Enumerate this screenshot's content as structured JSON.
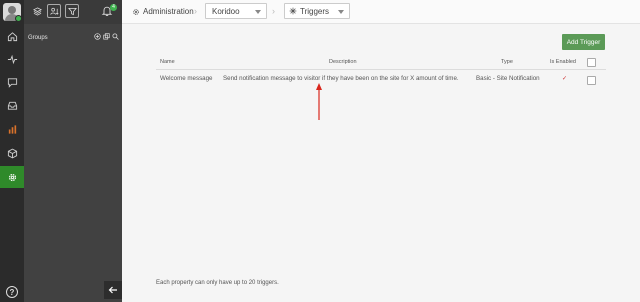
{
  "header": {
    "breadcrumb_admin": "Administration",
    "site_select": "Koridoo",
    "section_select": "Triggers"
  },
  "panel": {
    "groups_label": "Groups",
    "notification_count": "4"
  },
  "rail": {
    "help_label": "?"
  },
  "main": {
    "add_button": "Add Trigger",
    "columns": {
      "name": "Name",
      "description": "Description",
      "type": "Type",
      "enabled": "Is Enabled"
    },
    "rows": [
      {
        "name": "Welcome message",
        "description": "Send notification message to visitor if they have been on the site for X amount of time.",
        "type": "Basic - Site Notification",
        "enabled_mark": "✓"
      }
    ],
    "footer": "Each property can only have up to 20 triggers."
  },
  "colors": {
    "accent": "#2f8a2a",
    "button": "#5b9a57",
    "annotation_arrow": "#d9261c"
  }
}
